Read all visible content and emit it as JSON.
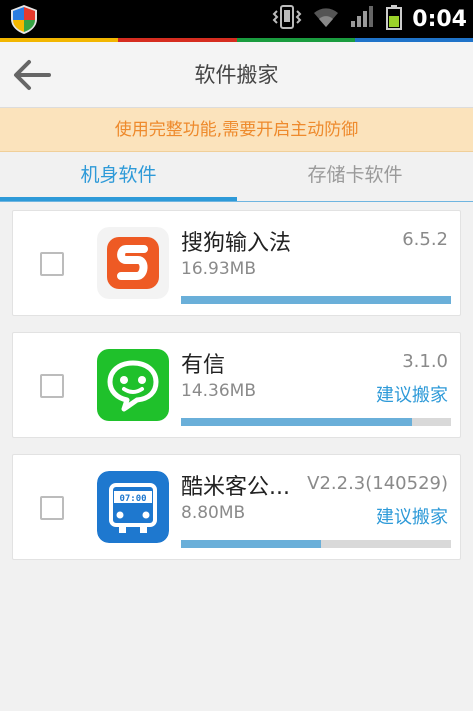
{
  "status_bar": {
    "time": "0:04",
    "strip_colors": [
      "#f2b600",
      "#d62d20",
      "#1a9c3f",
      "#1f73c9"
    ]
  },
  "header": {
    "title": "软件搬家"
  },
  "notice": {
    "text": "使用完整功能,需要开启主动防御"
  },
  "tabs": [
    {
      "label": "机身软件",
      "active": true
    },
    {
      "label": "存储卡软件",
      "active": false
    }
  ],
  "apps": [
    {
      "name": "搜狗输入法",
      "size": "16.93MB",
      "version": "6.5.2",
      "advice": "",
      "progress": 1.0,
      "icon": "sogou-input-icon",
      "icon_color": "#ee5a24"
    },
    {
      "name": "有信",
      "size": "14.36MB",
      "version": "3.1.0",
      "advice": "建议搬家",
      "progress": 0.855,
      "icon": "youxin-icon",
      "icon_color": "#1fc12b"
    },
    {
      "name": "酷米客公...",
      "size": "8.80MB",
      "version": "V2.2.3(140529)",
      "advice": "建议搬家",
      "progress": 0.52,
      "icon": "bus-icon",
      "icon_color": "#1e78cf",
      "icon_text": "07:00"
    }
  ]
}
